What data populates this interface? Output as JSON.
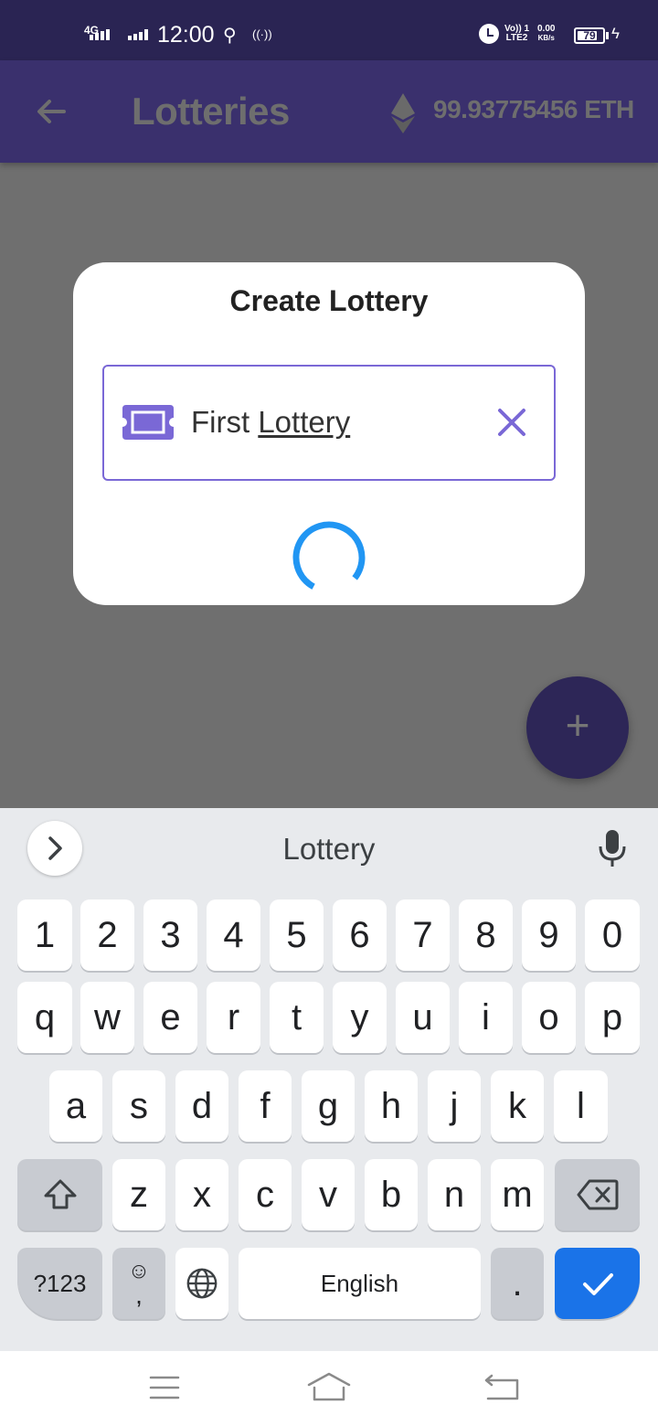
{
  "status_bar": {
    "network": "4G",
    "time": "12:00",
    "volte_line1": "Vo)) 1",
    "volte_line2": "LTE2",
    "speed_value": "0.00",
    "speed_unit": "KB/s",
    "battery_percent": "79",
    "battery_level": 0.79
  },
  "app_bar": {
    "back_icon": "arrow-left-icon",
    "title": "Lotteries",
    "currency_icon": "ethereum-icon",
    "balance": "99.93775456 ETH"
  },
  "dialog": {
    "title": "Create Lottery",
    "field_icon": "ticket-icon",
    "field_value_part1": "First ",
    "field_value_part2": "Lottery",
    "clear_icon": "close-icon",
    "loading": true,
    "accent_color": "#7a68d6",
    "spinner_color": "#2196f3"
  },
  "fab": {
    "icon": "plus-icon",
    "label": "+"
  },
  "keyboard": {
    "suggestion": "Lottery",
    "number_row": [
      "1",
      "2",
      "3",
      "4",
      "5",
      "6",
      "7",
      "8",
      "9",
      "0"
    ],
    "row1": [
      "q",
      "w",
      "e",
      "r",
      "t",
      "y",
      "u",
      "i",
      "o",
      "p"
    ],
    "row2": [
      "a",
      "s",
      "d",
      "f",
      "g",
      "h",
      "j",
      "k",
      "l"
    ],
    "row3": [
      "z",
      "x",
      "c",
      "v",
      "b",
      "n",
      "m"
    ],
    "symbols_label": "?123",
    "emoji_face": "☺",
    "emoji_comma": ",",
    "space_label": "English",
    "period_label": ".",
    "action_color": "#1a73e8"
  },
  "nav_bar": {
    "buttons": [
      "menu-icon",
      "home-icon",
      "back-icon"
    ]
  }
}
